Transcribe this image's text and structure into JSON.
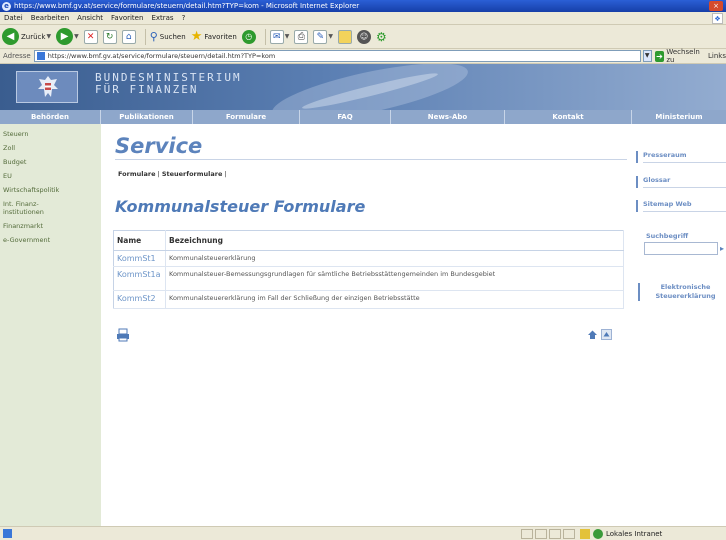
{
  "window": {
    "title": "https://www.bmf.gv.at/service/formulare/steuern/detail.htm?TYP=kom - Microsoft Internet Explorer",
    "close_label": "×"
  },
  "menu": [
    "Datei",
    "Bearbeiten",
    "Ansicht",
    "Favoriten",
    "Extras",
    "?"
  ],
  "toolbar": {
    "back": "Zurück",
    "search": "Suchen",
    "favorites": "Favoriten"
  },
  "address": {
    "label": "Adresse",
    "url": "https://www.bmf.gv.at/service/formulare/steuern/detail.htm?TYP=kom",
    "go": "Wechseln zu",
    "links": "Links"
  },
  "site": {
    "ministry_line1": "BUNDESMINISTERIUM",
    "ministry_line2": "FÜR FINANZEN"
  },
  "nav": [
    {
      "label": "Behörden"
    },
    {
      "label": "Publikationen"
    },
    {
      "label": "Formulare"
    },
    {
      "label": "FAQ"
    },
    {
      "label": "News-Abo"
    },
    {
      "label": "Kontakt"
    },
    {
      "label": "Ministerium"
    }
  ],
  "sidebar": [
    {
      "label": "Steuern"
    },
    {
      "label": "Zoll"
    },
    {
      "label": "Budget"
    },
    {
      "label": "EU"
    },
    {
      "label": "Wirtschaftspolitik"
    },
    {
      "label": "Int. Finanz-"
    },
    {
      "label": "institutionen"
    },
    {
      "label": "Finanzmarkt"
    },
    {
      "label": "e-Government"
    }
  ],
  "main": {
    "section_title": "Service",
    "breadcrumb_1": "Formulare",
    "breadcrumb_sep": " | ",
    "breadcrumb_2": "Steuerformulare",
    "breadcrumb_end": " |",
    "heading": "Kommunalsteuer Formulare",
    "table": {
      "col_name": "Name",
      "col_desc": "Bezeichnung",
      "rows": [
        {
          "code": "KommSt1",
          "desc": "Kommunalsteuererklärung"
        },
        {
          "code": "KommSt1a",
          "desc": "Kommunalsteuer-Bemessungsgrundlagen für sämtliche Betriebsstättengemeinden im Bundesgebiet"
        },
        {
          "code": "KommSt2",
          "desc": "Kommunalsteuererklärung im Fall der Schließung der einzigen Betriebsstätte"
        }
      ]
    }
  },
  "right": {
    "links": [
      "Presseraum",
      "Glossar",
      "Sitemap",
      "Web"
    ],
    "search_label": "Suchbegriff",
    "search_value": "",
    "ek_line1": "Elektronische",
    "ek_line2": "Steuererklärung"
  },
  "status": {
    "zone": "Lokales Intranet"
  }
}
